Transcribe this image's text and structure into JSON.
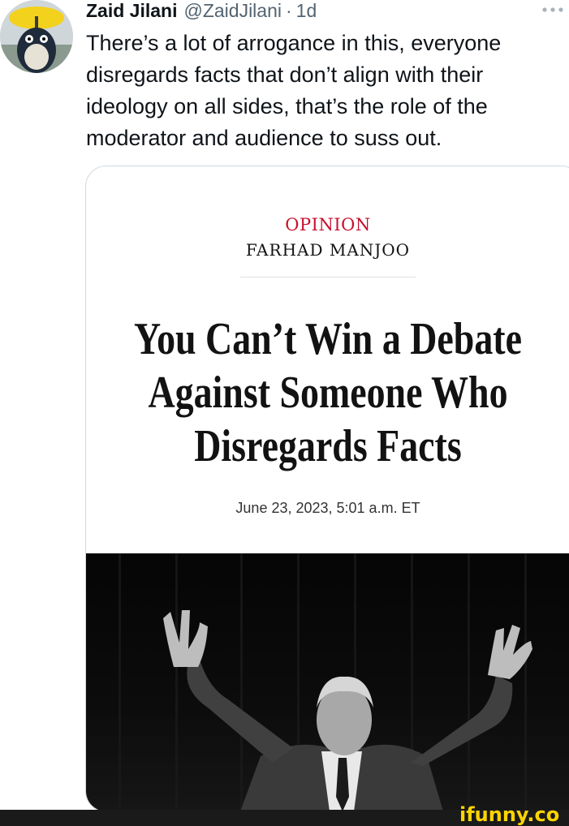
{
  "tweet": {
    "author_name": "Zaid Jilani",
    "author_handle": "@ZaidJilani",
    "separator": "·",
    "time": "1d",
    "more_icon": "more-horizontal-icon",
    "text_lines": [
      "There’s a lot of arrogance in this, everyone",
      "disregards facts that don’t align with their",
      "ideology on all sides, that’s the role of the",
      "moderator and audience to suss out."
    ]
  },
  "card": {
    "kicker": "OPINION",
    "byline": "FARHAD MANJOO",
    "headline_lines": [
      "You Can’t Win a Debate",
      "Against Someone Who",
      "Disregards Facts"
    ],
    "date": "June 23, 2023, 5:01 a.m. ET"
  },
  "watermark": "ifunny.co",
  "colors": {
    "kicker_red": "#c8102e",
    "handle_gray": "#536471",
    "card_border": "#cfd9de",
    "watermark_yellow": "#ffd400"
  }
}
